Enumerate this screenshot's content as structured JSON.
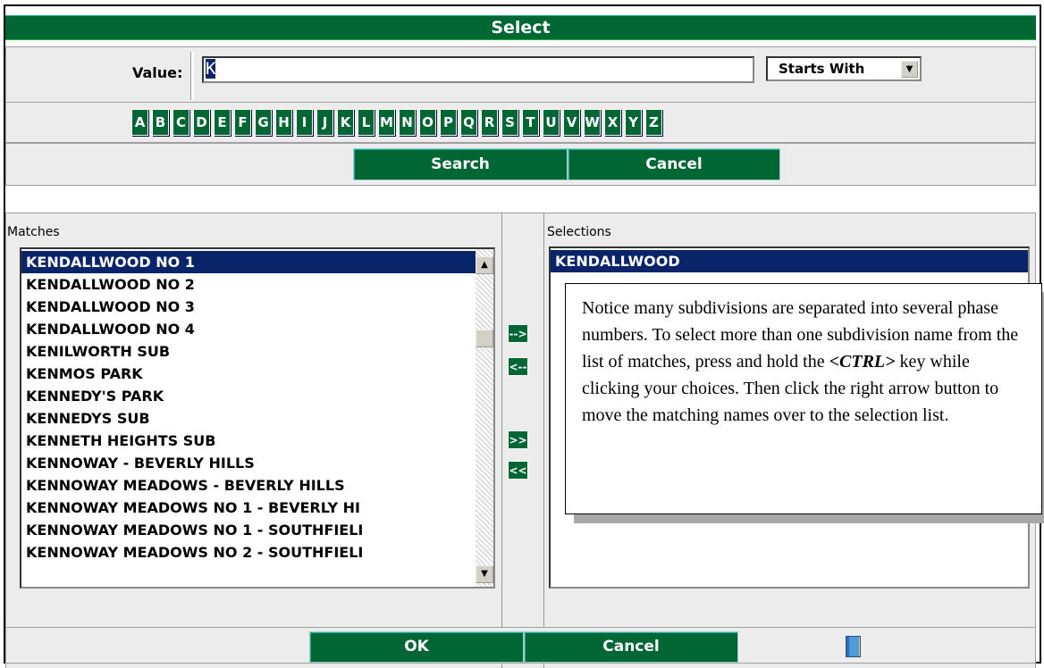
{
  "title": "Select",
  "value_label": "Value:",
  "value_input": "K",
  "match_mode": "Starts With",
  "letters": [
    "A",
    "B",
    "C",
    "D",
    "E",
    "F",
    "G",
    "H",
    "I",
    "J",
    "K",
    "L",
    "M",
    "N",
    "O",
    "P",
    "Q",
    "R",
    "S",
    "T",
    "U",
    "V",
    "W",
    "X",
    "Y",
    "Z"
  ],
  "search_label": "Search",
  "cancel_top_label": "Cancel",
  "matches_label": "Matches",
  "matches": [
    "KENDALLWOOD NO 1",
    "KENDALLWOOD NO 2",
    "KENDALLWOOD NO 3",
    "KENDALLWOOD NO 4",
    "KENILWORTH SUB",
    "KENMOS PARK",
    "KENNEDY'S PARK",
    "KENNEDYS SUB",
    "KENNETH HEIGHTS SUB",
    "KENNOWAY - BEVERLY HILLS",
    "KENNOWAY MEADOWS - BEVERLY HILLS",
    "KENNOWAY MEADOWS NO 1 - BEVERLY HI",
    "KENNOWAY MEADOWS NO 1 - SOUTHFIELI",
    "KENNOWAY MEADOWS NO 2 - SOUTHFIELI"
  ],
  "selected_match_index": 0,
  "selections_label": "Selections",
  "selections": [
    "KENDALLWOOD"
  ],
  "move_right_label": "-->",
  "move_left_label": "<--",
  "move_all_right_label": ">>",
  "move_all_left_label": "<<",
  "ok_label": "OK",
  "cancel_bottom_label": "Cancel",
  "callout": {
    "text_before": "Notice many subdivisions are separated into several phase numbers.  To select more than one subdivision name from the list of matches, press and hold the ",
    "key": "<CTRL>",
    "text_after": " key while clicking your choices.  Then click the right arrow button to move the matching names over to the selection list."
  },
  "icons": {
    "scroll_up": "scroll-up-arrow-icon",
    "scroll_down": "scroll-down-arrow-icon",
    "dropdown": "dropdown-arrow-icon",
    "book": "address-book-icon"
  },
  "colors": {
    "accent_green": "#006633",
    "selection_blue": "#0a246a",
    "panel_gray": "#ececec"
  }
}
